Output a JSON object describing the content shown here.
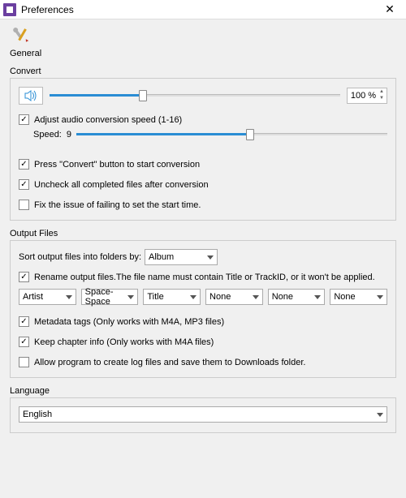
{
  "window": {
    "title": "Preferences"
  },
  "general": {
    "label": "General"
  },
  "convert": {
    "section_label": "Convert",
    "volume_percent_text": "100 %",
    "volume_fill_percent": 32,
    "adjust_speed_label": "Adjust audio conversion speed (1-16)",
    "adjust_speed_checked": true,
    "speed_label": "Speed:",
    "speed_value": "9",
    "speed_fill_percent": 56,
    "press_convert_label": "Press \"Convert\" button to start conversion",
    "press_convert_checked": true,
    "uncheck_completed_label": "Uncheck all completed files after conversion",
    "uncheck_completed_checked": true,
    "fix_start_time_label": "Fix the issue of failing to set the start time.",
    "fix_start_time_checked": false
  },
  "output": {
    "section_label": "Output Files",
    "sort_label": "Sort output files into folders by:",
    "sort_value": "Album",
    "rename_checked": true,
    "rename_label": "Rename output files.The file name must contain Title or TrackID, or it won't be applied.",
    "fields": [
      "Artist",
      "Space-Space",
      "Title",
      "None",
      "None",
      "None"
    ],
    "metadata_checked": true,
    "metadata_label": "Metadata tags (Only works with M4A, MP3 files)",
    "chapter_checked": true,
    "chapter_label": "Keep chapter info (Only works with M4A files)",
    "logs_checked": false,
    "logs_label": "Allow program to create log files and save them to Downloads folder."
  },
  "language": {
    "section_label": "Language",
    "value": "English"
  }
}
